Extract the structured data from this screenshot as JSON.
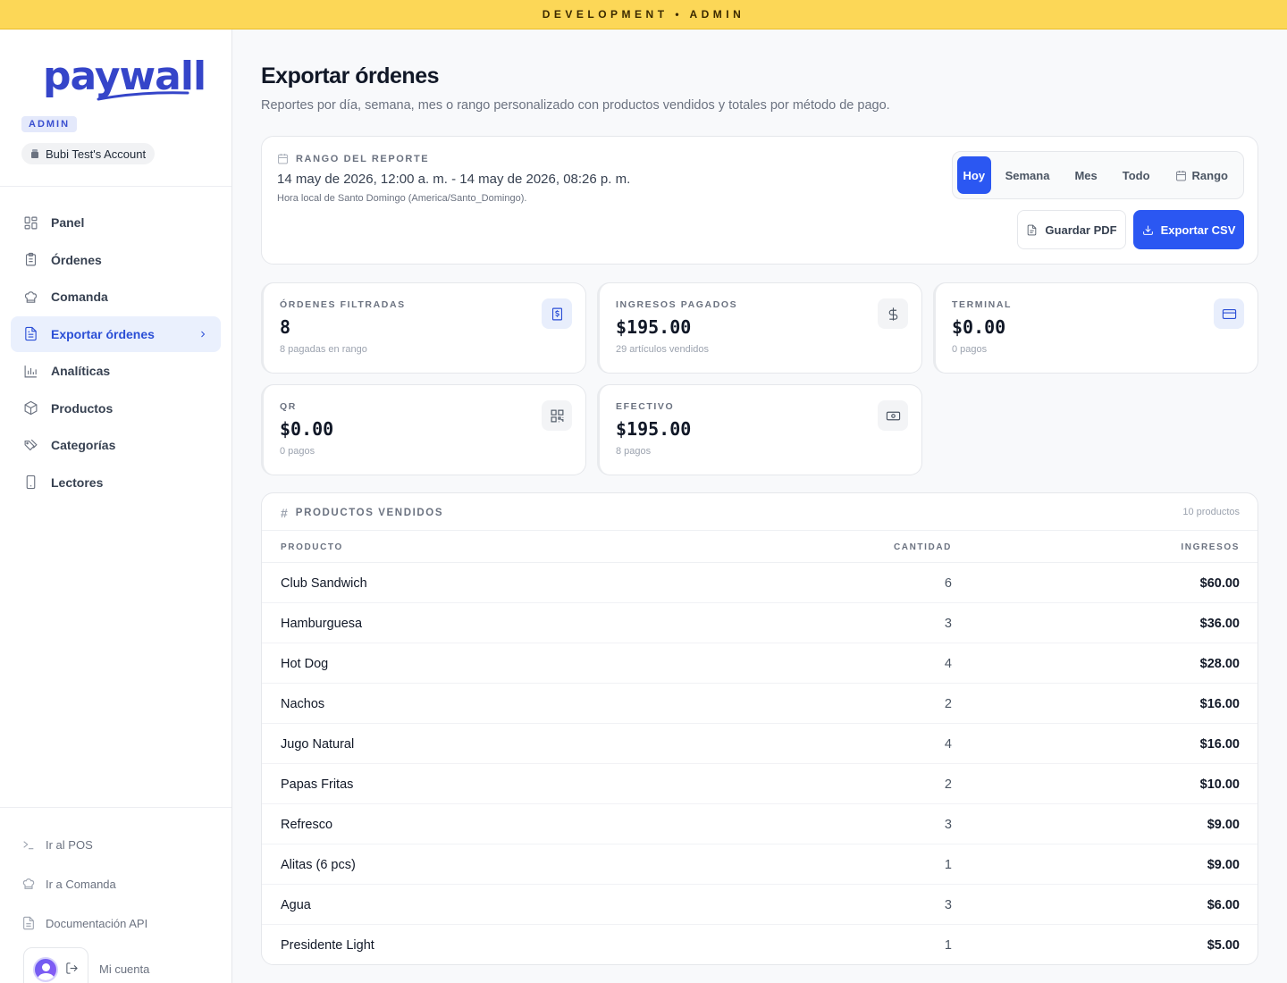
{
  "banner": "DEVELOPMENT • ADMIN",
  "brand": {
    "logo": "paywall",
    "role_badge": "ADMIN",
    "account": "Bubi Test's Account",
    "accent": "#2b57f2"
  },
  "nav": [
    {
      "label": "Panel",
      "icon": "grid-icon"
    },
    {
      "label": "Órdenes",
      "icon": "clipboard-icon"
    },
    {
      "label": "Comanda",
      "icon": "chef-hat-icon"
    },
    {
      "label": "Exportar órdenes",
      "icon": "file-text-icon",
      "active": true
    },
    {
      "label": "Analíticas",
      "icon": "bar-chart-icon"
    },
    {
      "label": "Productos",
      "icon": "package-icon"
    },
    {
      "label": "Categorías",
      "icon": "tags-icon"
    },
    {
      "label": "Lectores",
      "icon": "tablet-icon"
    }
  ],
  "footer_links": [
    {
      "label": "Ir al POS",
      "icon": "terminal-icon"
    },
    {
      "label": "Ir a Comanda",
      "icon": "chef-hat-icon"
    },
    {
      "label": "Documentación API",
      "icon": "file-text-icon"
    }
  ],
  "account_label": "Mi cuenta",
  "page": {
    "title": "Exportar órdenes",
    "subtitle": "Reportes por día, semana, mes o rango personalizado con productos vendidos y totales por método de pago."
  },
  "range": {
    "label": "RANGO DEL REPORTE",
    "value": "14 may de 2026, 12:00 a. m. - 14 may de 2026, 08:26 p. m.",
    "timezone": "Hora local de Santo Domingo (America/Santo_Domingo).",
    "segments": [
      "Hoy",
      "Semana",
      "Mes",
      "Todo",
      "Rango"
    ],
    "selected": "Hoy",
    "pdf_label": "Guardar PDF",
    "csv_label": "Exportar CSV"
  },
  "stats": [
    {
      "label": "ÓRDENES FILTRADAS",
      "value": "8",
      "note": "8 pagadas en rango",
      "icon": "receipt-icon"
    },
    {
      "label": "INGRESOS PAGADOS",
      "value": "$195.00",
      "note": "29 artículos vendidos",
      "icon": "dollar-icon"
    },
    {
      "label": "TERMINAL",
      "value": "$0.00",
      "note": "0 pagos",
      "icon": "credit-card-icon"
    },
    {
      "label": "QR",
      "value": "$0.00",
      "note": "0 pagos",
      "icon": "qr-code-icon"
    },
    {
      "label": "EFECTIVO",
      "value": "$195.00",
      "note": "8 pagos",
      "icon": "banknote-icon"
    }
  ],
  "products": {
    "title": "PRODUCTOS VENDIDOS",
    "count": "10 productos",
    "columns": [
      "PRODUCTO",
      "CANTIDAD",
      "INGRESOS"
    ],
    "rows": [
      {
        "name": "Club Sandwich",
        "qty": "6",
        "revenue": "$60.00"
      },
      {
        "name": "Hamburguesa",
        "qty": "3",
        "revenue": "$36.00"
      },
      {
        "name": "Hot Dog",
        "qty": "4",
        "revenue": "$28.00"
      },
      {
        "name": "Nachos",
        "qty": "2",
        "revenue": "$16.00"
      },
      {
        "name": "Jugo Natural",
        "qty": "4",
        "revenue": "$16.00"
      },
      {
        "name": "Papas Fritas",
        "qty": "2",
        "revenue": "$10.00"
      },
      {
        "name": "Refresco",
        "qty": "3",
        "revenue": "$9.00"
      },
      {
        "name": "Alitas (6 pcs)",
        "qty": "1",
        "revenue": "$9.00"
      },
      {
        "name": "Agua",
        "qty": "3",
        "revenue": "$6.00"
      },
      {
        "name": "Presidente Light",
        "qty": "1",
        "revenue": "$5.00"
      }
    ]
  }
}
